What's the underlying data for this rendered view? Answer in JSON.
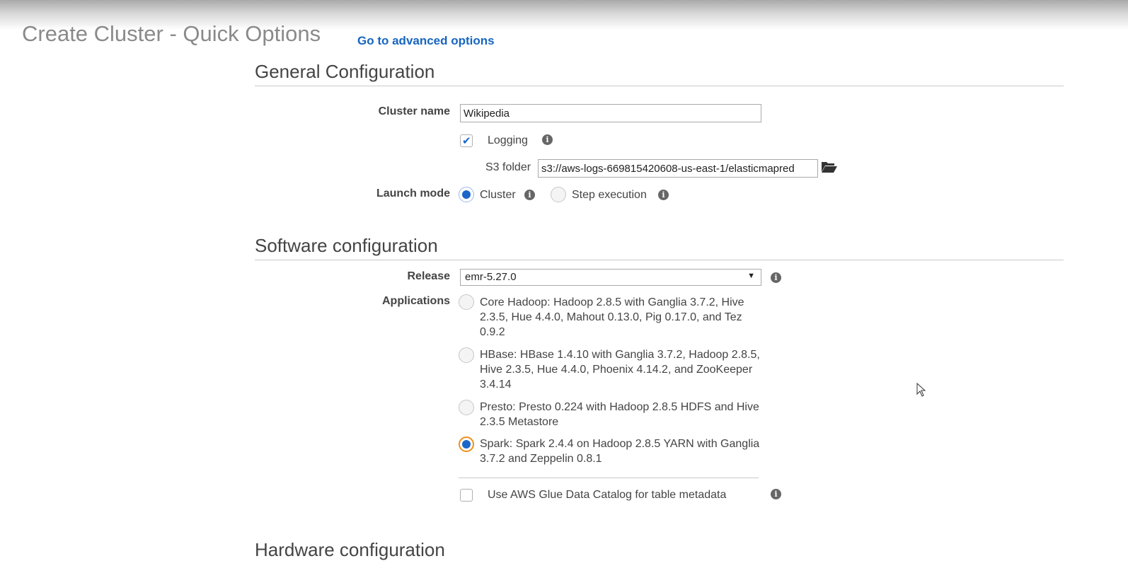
{
  "page": {
    "title": "Create Cluster - Quick Options",
    "advanced_link": "Go to advanced options"
  },
  "general": {
    "section_title": "General Configuration",
    "cluster_name_label": "Cluster name",
    "cluster_name_value": "Wikipedia",
    "logging_label": "Logging",
    "logging_checked": true,
    "s3_folder_label": "S3 folder",
    "s3_folder_value": "s3://aws-logs-669815420608-us-east-1/elasticmapred",
    "launch_mode_label": "Launch mode",
    "launch_mode_options": [
      "Cluster",
      "Step execution"
    ],
    "launch_mode_selected": "Cluster"
  },
  "software": {
    "section_title": "Software configuration",
    "release_label": "Release",
    "release_value": "emr-5.27.0",
    "applications_label": "Applications",
    "applications": [
      {
        "text": "Core Hadoop: Hadoop 2.8.5 with Ganglia 3.7.2, Hive 2.3.5, Hue 4.4.0, Mahout 0.13.0, Pig 0.17.0, and Tez 0.9.2",
        "selected": false
      },
      {
        "text": "HBase: HBase 1.4.10 with Ganglia 3.7.2, Hadoop 2.8.5, Hive 2.3.5, Hue 4.4.0, Phoenix 4.14.2, and ZooKeeper 3.4.14",
        "selected": false
      },
      {
        "text": "Presto: Presto 0.224 with Hadoop 2.8.5 HDFS and Hive 2.3.5 Metastore",
        "selected": false
      },
      {
        "text": "Spark: Spark 2.4.4 on Hadoop 2.8.5 YARN with Ganglia 3.7.2 and Zeppelin 0.8.1",
        "selected": true
      }
    ],
    "glue_label": "Use AWS Glue Data Catalog for table metadata",
    "glue_checked": false
  },
  "hardware": {
    "section_title": "Hardware configuration"
  },
  "colors": {
    "link": "#1665c0",
    "radio_selected": "#1b66c9",
    "focus_ring": "#ef8f1c"
  },
  "icons": {
    "info": "info-icon",
    "folder": "folder-open-icon",
    "cursor": "mouse-cursor-icon"
  }
}
